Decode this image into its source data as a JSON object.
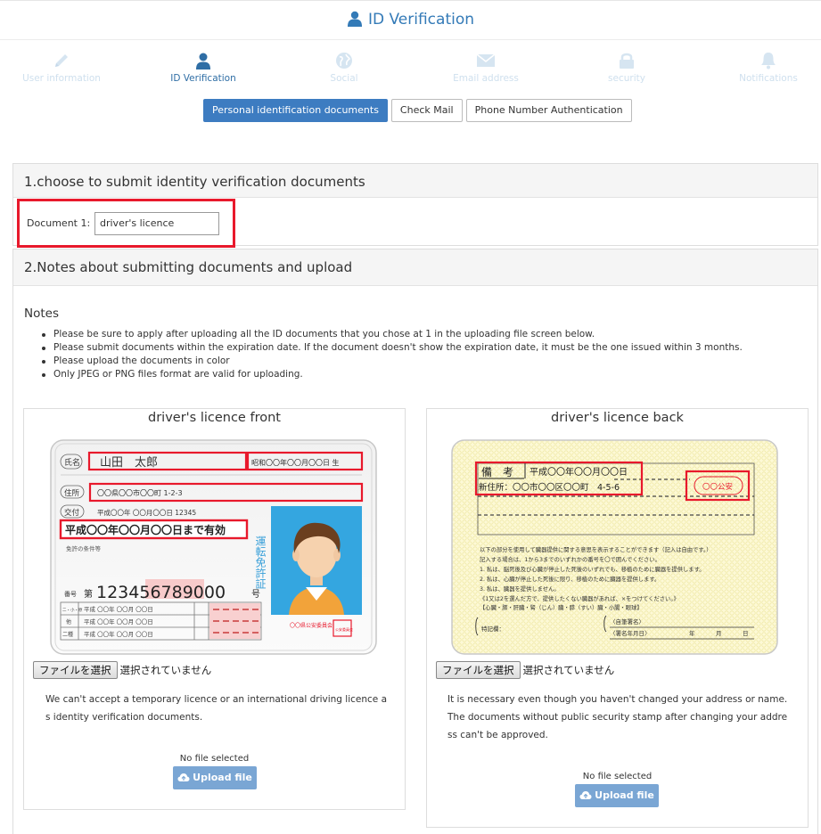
{
  "title": "ID Verification",
  "steps": [
    {
      "label": "User information",
      "icon": "pencil-icon"
    },
    {
      "label": "ID Verification",
      "icon": "user-icon"
    },
    {
      "label": "Social",
      "icon": "globe-icon"
    },
    {
      "label": "Email address",
      "icon": "envelope-icon"
    },
    {
      "label": "security",
      "icon": "lock-icon"
    },
    {
      "label": "Notifications",
      "icon": "bell-icon"
    }
  ],
  "tabs": [
    {
      "label": "Personal identification documents",
      "active": true
    },
    {
      "label": "Check Mail",
      "active": false
    },
    {
      "label": "Phone Number Authentication",
      "active": false
    }
  ],
  "section1": {
    "heading": "1.choose to submit identity verification documents",
    "doc_label": "Document 1:",
    "doc_value": "driver's licence"
  },
  "section2": {
    "heading": "2.Notes about submitting documents and upload",
    "notes_title": "Notes",
    "notes": [
      "Please be sure to apply after uploading all the ID documents that you chose at 1 in the uploading file screen below.",
      "Please submit documents within the expiration date. If the document doesn't show the expiration date, it must be the one issued within 3 months.",
      "Please upload the documents in color",
      "Only JPEG or PNG files format are valid for uploading."
    ]
  },
  "front": {
    "title": "driver's licence front",
    "choose_file": "ファイルを選択",
    "file_status": "選択されていません",
    "desc": "We can't accept a temporary licence or an international driving licence as identity verification documents.",
    "no_file": "No file selected",
    "upload": "Upload file",
    "card": {
      "name_label": "氏名",
      "name": "山田　太郎",
      "birth": "昭和〇〇年〇〇月〇〇日 生",
      "address_label": "住所",
      "address": "〇〇県〇〇市〇〇町 1-2-3",
      "issue_label": "交付",
      "issue": "平成〇〇年 〇〇月〇〇日 12345",
      "expiry": "平成〇〇年〇〇月〇〇日まで有効",
      "conditions": "免許の条件等",
      "number_label": "番号",
      "number_prefix": "第",
      "number": "123456789000",
      "number_suffix": "号",
      "row1_label": "二・小・原",
      "row2_label": "他",
      "row3_label": "二種",
      "row_date": "平成 〇〇年 〇〇月 〇〇日",
      "vertical": "運転免許証",
      "authority": "〇〇県公安委員会",
      "seal": "公安委員会"
    }
  },
  "back": {
    "title": "driver's licence back",
    "choose_file": "ファイルを選択",
    "file_status": "選択されていません",
    "desc": "It is necessary even though you haven't changed your address or name. The documents without public security stamp after changing your address can't be approved.",
    "no_file": "No file selected",
    "upload": "Upload file",
    "card": {
      "remarks_label": "備　考",
      "remarks_date": "平成〇〇年〇〇月〇〇日",
      "new_address": "新住所：〇〇市〇〇区〇〇町　4-5-6",
      "stamp": "〇〇公安",
      "organ_lines": [
        "以下の部分を使用して臓器提供に関する意思を表示することができます（記入は自由です。）",
        "記入する場合は、1から3までのいずれかの番号を〇で囲んでください。",
        "1. 私は、脳死後及び心臓が停止した死後のいずれでも、移植のために臓器を提供します。",
        "2. 私は、心臓が停止した死後に限り、移植のために臓器を提供します。",
        "3. 私は、臓器を提供しません。",
        "《1又は2を選んだ方で、提供したくない臓器があれば、×をつけてください。》",
        "【心臓・肺・肝臓・腎（じん）臓・膵（すい）臓・小腸・眼球】"
      ],
      "special": "特記欄：",
      "signature": "〈自筆署名〉",
      "sign_date": "〈署名年月日〉",
      "year": "年",
      "month": "月",
      "day": "日"
    }
  },
  "colors": {
    "accent": "#3d7cc1",
    "upload_button": "#7aa6d4",
    "highlight": "#e8192c"
  }
}
